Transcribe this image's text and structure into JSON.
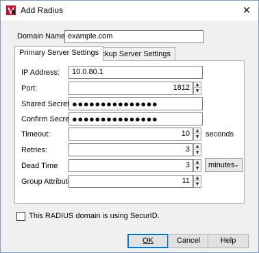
{
  "window": {
    "title": "Add Radius",
    "close_glyph": "✕",
    "icon": "watchguard-app-icon"
  },
  "domain_name": {
    "label": "Domain Name",
    "value": "example.com"
  },
  "tabs": [
    {
      "label": "Primary Server Settings",
      "active": true
    },
    {
      "label": "Backup Server Settings",
      "active": false
    }
  ],
  "primary": {
    "ip_address": {
      "label": "IP Address:",
      "value": "10.0.80.1"
    },
    "port": {
      "label": "Port:",
      "value": "1812"
    },
    "shared_secret": {
      "label": "Shared Secret:",
      "value": "●●●●●●●●●●●●●●●"
    },
    "confirm_secret": {
      "label": "Confirm Secret:",
      "value": "●●●●●●●●●●●●●●●"
    },
    "timeout": {
      "label": "Timeout:",
      "value": "10",
      "unit": "seconds"
    },
    "retries": {
      "label": "Retries:",
      "value": "3"
    },
    "dead_time": {
      "label": "Dead Time",
      "value": "3",
      "unit_options_selected": "minutes"
    },
    "group_attribute": {
      "label": "Group Attribute:",
      "value": "11"
    }
  },
  "securid": {
    "label": "This RADIUS domain is using SecurID.",
    "checked": false
  },
  "buttons": {
    "ok": "OK",
    "cancel": "Cancel",
    "help": "Help"
  },
  "spinner": {
    "up": "▲",
    "down": "▼",
    "chevron": "⌄"
  },
  "colors": {
    "accent": "#0078d7",
    "window_bg": "#f0f0f0"
  }
}
